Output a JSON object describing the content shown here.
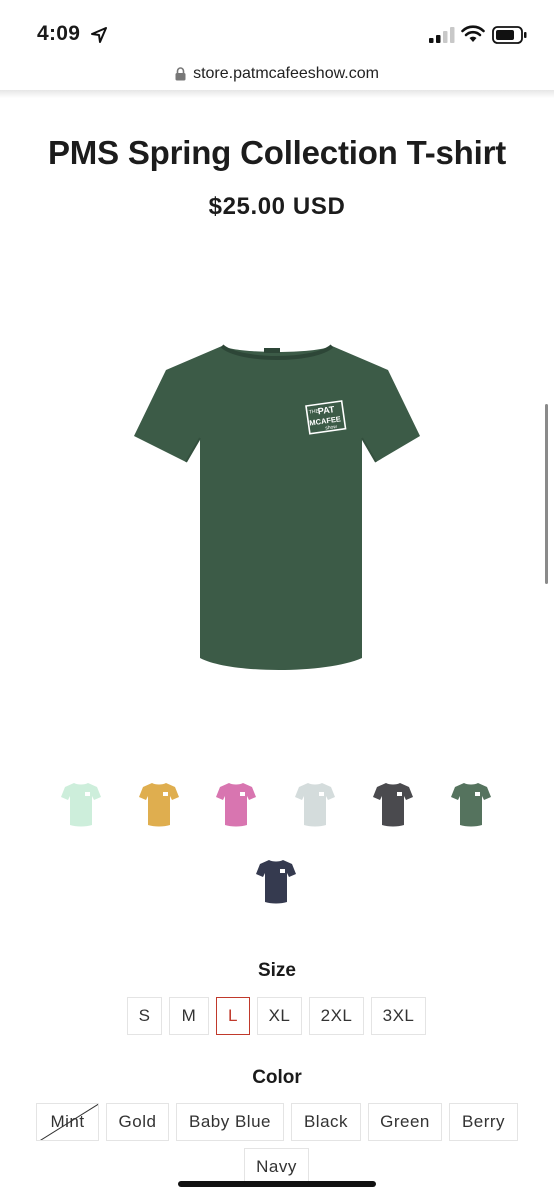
{
  "status": {
    "time": "4:09"
  },
  "browser": {
    "url": "store.patmcafeeshow.com"
  },
  "product": {
    "title": "PMS Spring Collection T-shirt",
    "price": "$25.00 USD",
    "main_image_color": "#3c5b47",
    "logo_text": {
      "line1": "THE",
      "line2": "PAT",
      "line3": "MCAFEE",
      "line4": "show"
    }
  },
  "thumbnails": [
    {
      "name": "mint",
      "color": "#cdeedb"
    },
    {
      "name": "gold",
      "color": "#dfae4f"
    },
    {
      "name": "berry",
      "color": "#d875b0"
    },
    {
      "name": "baby-blue",
      "color": "#d4dcdc"
    },
    {
      "name": "black",
      "color": "#4a4a4e"
    },
    {
      "name": "green",
      "color": "#55735e"
    },
    {
      "name": "navy",
      "color": "#353a4f"
    }
  ],
  "size": {
    "heading": "Size",
    "options": [
      "S",
      "M",
      "L",
      "XL",
      "2XL",
      "3XL"
    ],
    "selected": "L"
  },
  "color": {
    "heading": "Color",
    "options": [
      "Mint",
      "Gold",
      "Baby Blue",
      "Black",
      "Green",
      "Berry",
      "Navy"
    ],
    "sold_out": [
      "Mint"
    ]
  },
  "colors": {
    "selected_accent": "#c0392b",
    "border": "#e4e4e4"
  }
}
